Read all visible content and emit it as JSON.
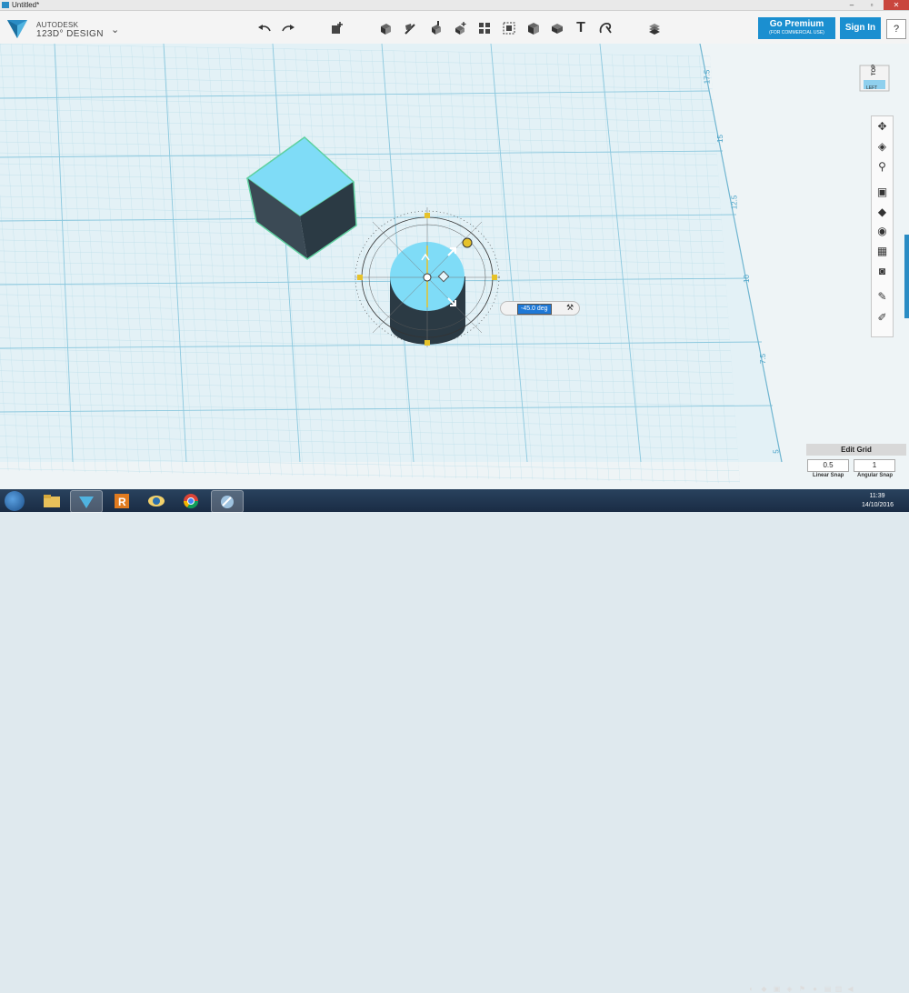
{
  "window": {
    "title": "Untitled*",
    "minimize": "–",
    "maximize": "▫",
    "close": "✕"
  },
  "brand": {
    "line1": "AUTODESK",
    "line2": "123D° DESIGN",
    "menu_chevron": "⌄"
  },
  "toolbar": {
    "icons": [
      "undo-icon",
      "redo-icon",
      "primitives-icon",
      "transform-icon",
      "sketch-icon",
      "construct-icon",
      "modify-icon",
      "pattern-icon",
      "grouping-icon",
      "combine-icon",
      "measure-icon",
      "text-icon",
      "snap-icon",
      "material-icon"
    ],
    "text_tool_glyph": "T"
  },
  "premium": {
    "label": "Go Premium",
    "sublabel": "(FOR COMMERCIAL USE)"
  },
  "signin_label": "Sign In",
  "help_label": "?",
  "viewcube": {
    "top_label": "TOP",
    "left_label": "LEFT"
  },
  "grid_axis_labels": [
    "17.5",
    "15",
    "12.5",
    "10",
    "7.5",
    "5"
  ],
  "rotate_input": {
    "value": "-45.0 deg"
  },
  "edit_grid": {
    "title": "Edit Grid",
    "linear_value": "0.5",
    "angular_value": "1",
    "linear_label": "Linear Snap",
    "angular_label": "Angular Snap"
  },
  "clock": {
    "time": "11:39",
    "date": "14/10/2016"
  },
  "taskbar_apps": [
    "explorer",
    "123d-design",
    "revit",
    "app-eye",
    "chrome",
    "control-panel"
  ],
  "colors": {
    "accent": "#1b8fd0",
    "model_blue": "#7fdcf7",
    "model_dark": "#2b3a44"
  }
}
